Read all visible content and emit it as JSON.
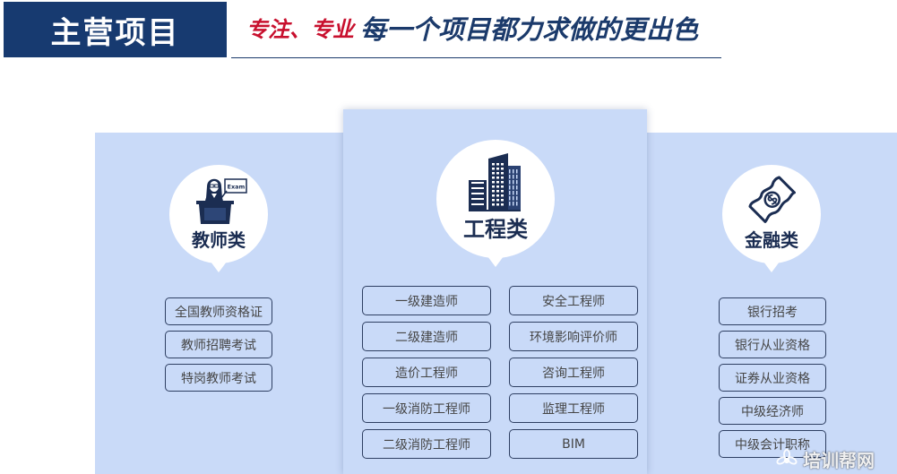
{
  "header": {
    "title": "主营项目",
    "slogan_accent": "专注、专业",
    "slogan_main": "每一个项目都力求做的更出色"
  },
  "theme": {
    "navy": "#173a70",
    "accent_red": "#c8102e",
    "panel_blue": "#c9daf8",
    "button_border": "#2e3f62"
  },
  "categories": [
    {
      "label": "教师类",
      "icon": "teacher-podium-icon",
      "icon_text": "Exam",
      "items": [
        "全国教师资格证",
        "教师招聘考试",
        "特岗教师考试"
      ]
    },
    {
      "label": "工程类",
      "icon": "buildings-icon",
      "columns": [
        [
          "一级建造师",
          "二级建造师",
          "造价工程师",
          "一级消防工程师",
          "二级消防工程师"
        ],
        [
          "安全工程师",
          "环境影响评价师",
          "咨询工程师",
          "监理工程师",
          "BIM"
        ]
      ]
    },
    {
      "label": "金融类",
      "icon": "money-bill-icon",
      "items": [
        "银行招考",
        "银行从业资格",
        "证券从业资格",
        "中级经济师",
        "中级会计职称"
      ]
    }
  ],
  "watermark": {
    "text": "培训帮网",
    "icon": "lotus-logo-icon"
  }
}
